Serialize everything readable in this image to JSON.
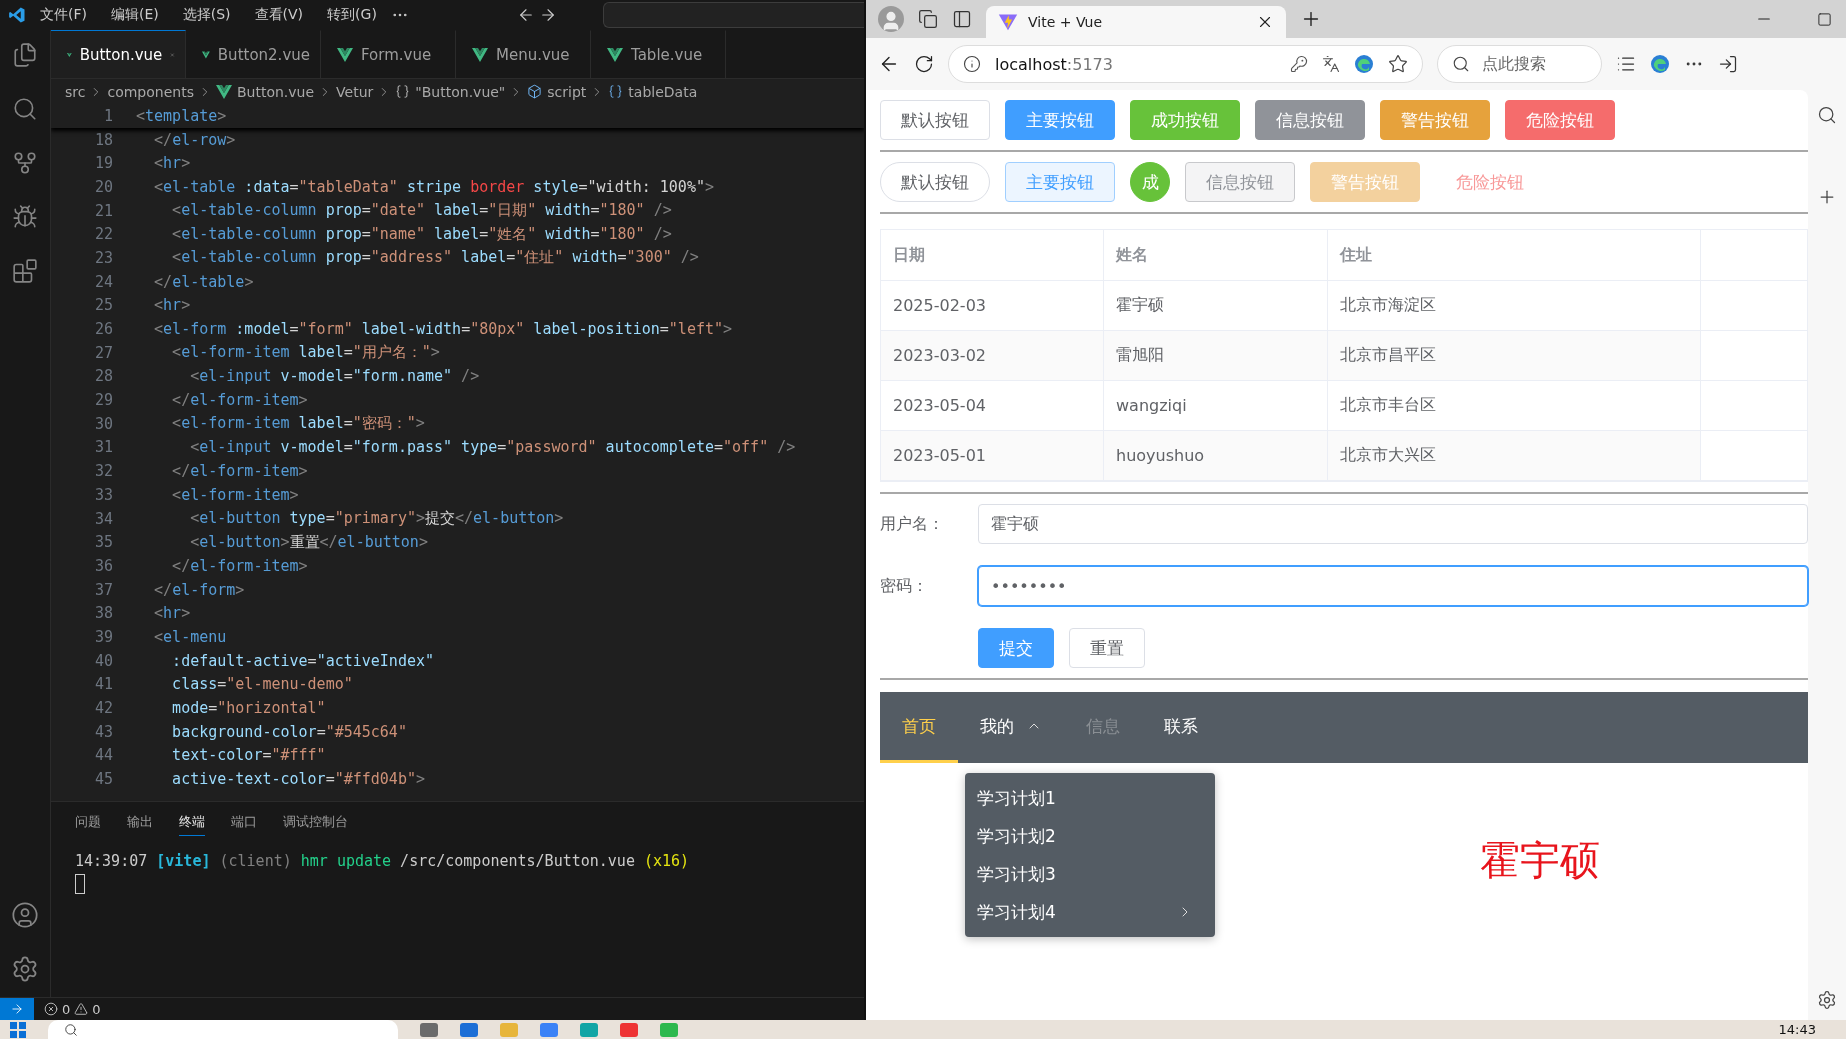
{
  "vscode": {
    "menu": [
      "文件(F)",
      "编辑(E)",
      "选择(S)",
      "查看(V)",
      "转到(G)"
    ],
    "tabs": [
      {
        "label": "Button.vue",
        "selected": true
      },
      {
        "label": "Button2.vue",
        "selected": false
      },
      {
        "label": "Form.vue",
        "selected": false
      },
      {
        "label": "Menu.vue",
        "selected": false
      },
      {
        "label": "Table.vue",
        "selected": false
      }
    ],
    "breadcrumb": [
      {
        "kind": "plain",
        "text": "src"
      },
      {
        "kind": "plain",
        "text": "components"
      },
      {
        "kind": "vue",
        "text": "Button.vue"
      },
      {
        "kind": "plain",
        "text": "Vetur"
      },
      {
        "kind": "braces",
        "text": "\"Button.vue\""
      },
      {
        "kind": "module",
        "text": "script"
      },
      {
        "kind": "field",
        "text": "tableData"
      }
    ],
    "sticky_line": {
      "num": "1",
      "tokens": [
        {
          "kind": "p",
          "text": "<"
        },
        {
          "kind": "tag",
          "text": "template"
        },
        {
          "kind": "p",
          "text": ">"
        }
      ]
    },
    "lines": [
      {
        "num": "18",
        "tokens": [
          {
            "kind": "p",
            "text": "  </"
          },
          {
            "kind": "tag",
            "text": "el-row"
          },
          {
            "kind": "p",
            "text": ">"
          }
        ]
      },
      {
        "num": "19",
        "tokens": [
          {
            "kind": "p",
            "text": "  <"
          },
          {
            "kind": "tag",
            "text": "hr"
          },
          {
            "kind": "p",
            "text": ">"
          }
        ]
      },
      {
        "num": "20",
        "tokens": [
          {
            "kind": "p",
            "text": "  <"
          },
          {
            "kind": "tag",
            "text": "el-table"
          },
          {
            "kind": "attr",
            "text": " :data"
          },
          {
            "kind": "txt",
            "text": "="
          },
          {
            "kind": "str",
            "text": "\"tableData\""
          },
          {
            "kind": "attr",
            "text": " stripe"
          },
          {
            "kind": "kw",
            "text": " border"
          },
          {
            "kind": "attr",
            "text": " style"
          },
          {
            "kind": "txt",
            "text": "="
          },
          {
            "kind": "txt",
            "text": "\"width: 100%\""
          },
          {
            "kind": "p",
            "text": ">"
          }
        ]
      },
      {
        "num": "21",
        "tokens": [
          {
            "kind": "p",
            "text": "    <"
          },
          {
            "kind": "tag",
            "text": "el-table-column"
          },
          {
            "kind": "attr",
            "text": " prop"
          },
          {
            "kind": "txt",
            "text": "="
          },
          {
            "kind": "str",
            "text": "\"date\""
          },
          {
            "kind": "attr",
            "text": " label"
          },
          {
            "kind": "txt",
            "text": "="
          },
          {
            "kind": "str",
            "text": "\"日期\""
          },
          {
            "kind": "attr",
            "text": " width"
          },
          {
            "kind": "txt",
            "text": "="
          },
          {
            "kind": "str",
            "text": "\"180\""
          },
          {
            "kind": "p",
            "text": " />"
          }
        ]
      },
      {
        "num": "22",
        "tokens": [
          {
            "kind": "p",
            "text": "    <"
          },
          {
            "kind": "tag",
            "text": "el-table-column"
          },
          {
            "kind": "attr",
            "text": " prop"
          },
          {
            "kind": "txt",
            "text": "="
          },
          {
            "kind": "str",
            "text": "\"name\""
          },
          {
            "kind": "attr",
            "text": " label"
          },
          {
            "kind": "txt",
            "text": "="
          },
          {
            "kind": "str",
            "text": "\"姓名\""
          },
          {
            "kind": "attr",
            "text": " width"
          },
          {
            "kind": "txt",
            "text": "="
          },
          {
            "kind": "str",
            "text": "\"180\""
          },
          {
            "kind": "p",
            "text": " />"
          }
        ]
      },
      {
        "num": "23",
        "tokens": [
          {
            "kind": "p",
            "text": "    <"
          },
          {
            "kind": "tag",
            "text": "el-table-column"
          },
          {
            "kind": "attr",
            "text": " prop"
          },
          {
            "kind": "txt",
            "text": "="
          },
          {
            "kind": "str",
            "text": "\"address\""
          },
          {
            "kind": "attr",
            "text": " label"
          },
          {
            "kind": "txt",
            "text": "="
          },
          {
            "kind": "str",
            "text": "\"住址\""
          },
          {
            "kind": "attr",
            "text": " width"
          },
          {
            "kind": "txt",
            "text": "="
          },
          {
            "kind": "str",
            "text": "\"300\""
          },
          {
            "kind": "p",
            "text": " />"
          }
        ]
      },
      {
        "num": "24",
        "tokens": [
          {
            "kind": "p",
            "text": "  </"
          },
          {
            "kind": "tag",
            "text": "el-table"
          },
          {
            "kind": "p",
            "text": ">"
          }
        ]
      },
      {
        "num": "25",
        "tokens": [
          {
            "kind": "p",
            "text": "  <"
          },
          {
            "kind": "tag",
            "text": "hr"
          },
          {
            "kind": "p",
            "text": ">"
          }
        ]
      },
      {
        "num": "26",
        "tokens": [
          {
            "kind": "p",
            "text": "  <"
          },
          {
            "kind": "tag",
            "text": "el-form"
          },
          {
            "kind": "attr",
            "text": " :model"
          },
          {
            "kind": "txt",
            "text": "="
          },
          {
            "kind": "str",
            "text": "\"form\""
          },
          {
            "kind": "attr",
            "text": " label-width"
          },
          {
            "kind": "txt",
            "text": "="
          },
          {
            "kind": "str",
            "text": "\"80px\""
          },
          {
            "kind": "attr",
            "text": " label-position"
          },
          {
            "kind": "txt",
            "text": "="
          },
          {
            "kind": "str",
            "text": "\"left\""
          },
          {
            "kind": "p",
            "text": ">"
          }
        ]
      },
      {
        "num": "27",
        "tokens": [
          {
            "kind": "p",
            "text": "    <"
          },
          {
            "kind": "tag",
            "text": "el-form-item"
          },
          {
            "kind": "attr",
            "text": " label"
          },
          {
            "kind": "txt",
            "text": "="
          },
          {
            "kind": "str",
            "text": "\"用户名：\""
          },
          {
            "kind": "p",
            "text": ">"
          }
        ]
      },
      {
        "num": "28",
        "tokens": [
          {
            "kind": "p",
            "text": "      <"
          },
          {
            "kind": "tag",
            "text": "el-input"
          },
          {
            "kind": "attr",
            "text": " v-model"
          },
          {
            "kind": "txt",
            "text": "="
          },
          {
            "kind": "expr",
            "text": "\"form.name\""
          },
          {
            "kind": "p",
            "text": " />"
          }
        ]
      },
      {
        "num": "29",
        "tokens": [
          {
            "kind": "p",
            "text": "    </"
          },
          {
            "kind": "tag",
            "text": "el-form-item"
          },
          {
            "kind": "p",
            "text": ">"
          }
        ]
      },
      {
        "num": "30",
        "tokens": [
          {
            "kind": "p",
            "text": "    <"
          },
          {
            "kind": "tag",
            "text": "el-form-item"
          },
          {
            "kind": "attr",
            "text": " label"
          },
          {
            "kind": "txt",
            "text": "="
          },
          {
            "kind": "str",
            "text": "\"密码：\""
          },
          {
            "kind": "p",
            "text": ">"
          }
        ]
      },
      {
        "num": "31",
        "tokens": [
          {
            "kind": "p",
            "text": "      <"
          },
          {
            "kind": "tag",
            "text": "el-input"
          },
          {
            "kind": "attr",
            "text": " v-model"
          },
          {
            "kind": "txt",
            "text": "="
          },
          {
            "kind": "expr",
            "text": "\"form.pass\""
          },
          {
            "kind": "attr",
            "text": " type"
          },
          {
            "kind": "txt",
            "text": "="
          },
          {
            "kind": "str",
            "text": "\"password\""
          },
          {
            "kind": "attr",
            "text": " autocomplete"
          },
          {
            "kind": "txt",
            "text": "="
          },
          {
            "kind": "str",
            "text": "\"off\""
          },
          {
            "kind": "p",
            "text": " />"
          }
        ]
      },
      {
        "num": "32",
        "tokens": [
          {
            "kind": "p",
            "text": "    </"
          },
          {
            "kind": "tag",
            "text": "el-form-item"
          },
          {
            "kind": "p",
            "text": ">"
          }
        ]
      },
      {
        "num": "33",
        "tokens": [
          {
            "kind": "p",
            "text": "    <"
          },
          {
            "kind": "tag",
            "text": "el-form-item"
          },
          {
            "kind": "p",
            "text": ">"
          }
        ]
      },
      {
        "num": "34",
        "tokens": [
          {
            "kind": "p",
            "text": "      <"
          },
          {
            "kind": "tag",
            "text": "el-button"
          },
          {
            "kind": "attr",
            "text": " type"
          },
          {
            "kind": "txt",
            "text": "="
          },
          {
            "kind": "str",
            "text": "\"primary\""
          },
          {
            "kind": "p",
            "text": ">"
          },
          {
            "kind": "txt",
            "text": "提交"
          },
          {
            "kind": "p",
            "text": "</"
          },
          {
            "kind": "tag",
            "text": "el-button"
          },
          {
            "kind": "p",
            "text": ">"
          }
        ]
      },
      {
        "num": "35",
        "tokens": [
          {
            "kind": "p",
            "text": "      <"
          },
          {
            "kind": "tag",
            "text": "el-button"
          },
          {
            "kind": "p",
            "text": ">"
          },
          {
            "kind": "txt",
            "text": "重置"
          },
          {
            "kind": "p",
            "text": "</"
          },
          {
            "kind": "tag",
            "text": "el-button"
          },
          {
            "kind": "p",
            "text": ">"
          }
        ]
      },
      {
        "num": "36",
        "tokens": [
          {
            "kind": "p",
            "text": "    </"
          },
          {
            "kind": "tag",
            "text": "el-form-item"
          },
          {
            "kind": "p",
            "text": ">"
          }
        ]
      },
      {
        "num": "37",
        "tokens": [
          {
            "kind": "p",
            "text": "  </"
          },
          {
            "kind": "tag",
            "text": "el-form"
          },
          {
            "kind": "p",
            "text": ">"
          }
        ]
      },
      {
        "num": "38",
        "tokens": [
          {
            "kind": "p",
            "text": "  <"
          },
          {
            "kind": "tag",
            "text": "hr"
          },
          {
            "kind": "p",
            "text": ">"
          }
        ]
      },
      {
        "num": "39",
        "tokens": [
          {
            "kind": "p",
            "text": "  <"
          },
          {
            "kind": "tag",
            "text": "el-menu"
          }
        ]
      },
      {
        "num": "40",
        "tokens": [
          {
            "kind": "attr",
            "text": "    :default-active"
          },
          {
            "kind": "txt",
            "text": "="
          },
          {
            "kind": "expr",
            "text": "\"activeIndex\""
          }
        ]
      },
      {
        "num": "41",
        "tokens": [
          {
            "kind": "attr",
            "text": "    class"
          },
          {
            "kind": "txt",
            "text": "="
          },
          {
            "kind": "str",
            "text": "\"el-menu-demo\""
          }
        ]
      },
      {
        "num": "42",
        "tokens": [
          {
            "kind": "attr",
            "text": "    mode"
          },
          {
            "kind": "txt",
            "text": "="
          },
          {
            "kind": "str",
            "text": "\"horizontal\""
          }
        ]
      },
      {
        "num": "43",
        "tokens": [
          {
            "kind": "attr",
            "text": "    background-color"
          },
          {
            "kind": "txt",
            "text": "="
          },
          {
            "kind": "str",
            "text": "\"#545c64\""
          }
        ]
      },
      {
        "num": "44",
        "tokens": [
          {
            "kind": "attr",
            "text": "    text-color"
          },
          {
            "kind": "txt",
            "text": "="
          },
          {
            "kind": "str",
            "text": "\"#fff\""
          }
        ]
      },
      {
        "num": "45",
        "tokens": [
          {
            "kind": "attr",
            "text": "    active-text-color"
          },
          {
            "kind": "txt",
            "text": "="
          },
          {
            "kind": "str",
            "text": "\"#ffd04b\""
          },
          {
            "kind": "p",
            "text": ">"
          }
        ]
      }
    ],
    "panel_tabs": [
      {
        "label": "问题",
        "selected": false
      },
      {
        "label": "输出",
        "selected": false
      },
      {
        "label": "终端",
        "selected": true
      },
      {
        "label": "端口",
        "selected": false
      },
      {
        "label": "调试控制台",
        "selected": false
      }
    ],
    "terminal": [
      {
        "kind": "time",
        "text": "14:39:07 "
      },
      {
        "kind": "tag",
        "text": "[vite]"
      },
      {
        "kind": "dim",
        "text": " (client)"
      },
      {
        "kind": "ok",
        "text": " hmr update"
      },
      {
        "kind": "path",
        "text": " /src/components/Button.vue"
      },
      {
        "kind": "count",
        "text": " (x16)"
      }
    ],
    "status": {
      "errors": "0",
      "warnings": "0"
    }
  },
  "browser": {
    "tab_title": "Vite + Vue",
    "host": "localhost",
    "port": ":5173",
    "search_placeholder": "点此搜索",
    "button_rows": [
      [
        {
          "label": "默认按钮",
          "color": "#606266",
          "kind": "default"
        },
        {
          "label": "主要按钮",
          "color": "#409eff",
          "kind": "solid"
        },
        {
          "label": "成功按钮",
          "color": "#67c23a",
          "kind": "solid"
        },
        {
          "label": "信息按钮",
          "color": "#909399",
          "kind": "solid"
        },
        {
          "label": "警告按钮",
          "color": "#e6a23c",
          "kind": "solid"
        },
        {
          "label": "危险按钮",
          "color": "#f56c6c",
          "kind": "solid"
        }
      ],
      [
        {
          "label": "默认按钮",
          "color": "#606266",
          "kind": "round"
        },
        {
          "label": "主要按钮",
          "color": "#409eff",
          "kind": "plain"
        },
        {
          "label": "成",
          "color": "#67c23a",
          "kind": "circle"
        },
        {
          "label": "信息按钮",
          "color": "#909399",
          "kind": "plain"
        },
        {
          "label": "警告按钮",
          "color": "#f3d19e",
          "kind": "disabled"
        },
        {
          "label": "危险按钮",
          "color": "#f89898",
          "kind": "text"
        }
      ]
    ],
    "table": {
      "columns": [
        "日期",
        "姓名",
        "住址"
      ],
      "rows": [
        [
          "2025-02-03",
          "霍宇硕",
          "北京市海淀区"
        ],
        [
          "2023-03-02",
          "雷旭阳",
          "北京市昌平区"
        ],
        [
          "2023-05-04",
          "wangziqi",
          "北京市丰台区"
        ],
        [
          "2023-05-01",
          "huoyushuo",
          "北京市大兴区"
        ]
      ]
    },
    "form": {
      "fields": [
        {
          "label": "用户名：",
          "value": "霍宇硕",
          "focused": false
        },
        {
          "label": "密码：",
          "value": "••••••••",
          "focused": true
        }
      ],
      "buttons": [
        {
          "label": "提交",
          "color": "#409eff",
          "kind": "solid"
        },
        {
          "label": "重置",
          "color": "#606266",
          "kind": "default"
        }
      ]
    },
    "menu": {
      "items": [
        {
          "label": "首页",
          "kind": "item",
          "selected": true,
          "disabled": false
        },
        {
          "label": "我的",
          "kind": "submenu",
          "selected": false,
          "disabled": false,
          "expanded": true,
          "children": [
            {
              "label": "学习计划1",
              "kind": "item"
            },
            {
              "label": "学习计划2",
              "kind": "item"
            },
            {
              "label": "学习计划3",
              "kind": "item"
            },
            {
              "label": "学习计划4",
              "kind": "submenu"
            }
          ]
        },
        {
          "label": "信息",
          "kind": "item",
          "selected": false,
          "disabled": true
        },
        {
          "label": "联系",
          "kind": "item",
          "selected": false,
          "disabled": false
        }
      ]
    },
    "signature": "霍宇硕"
  },
  "taskbar": {
    "clock": "14:43"
  }
}
